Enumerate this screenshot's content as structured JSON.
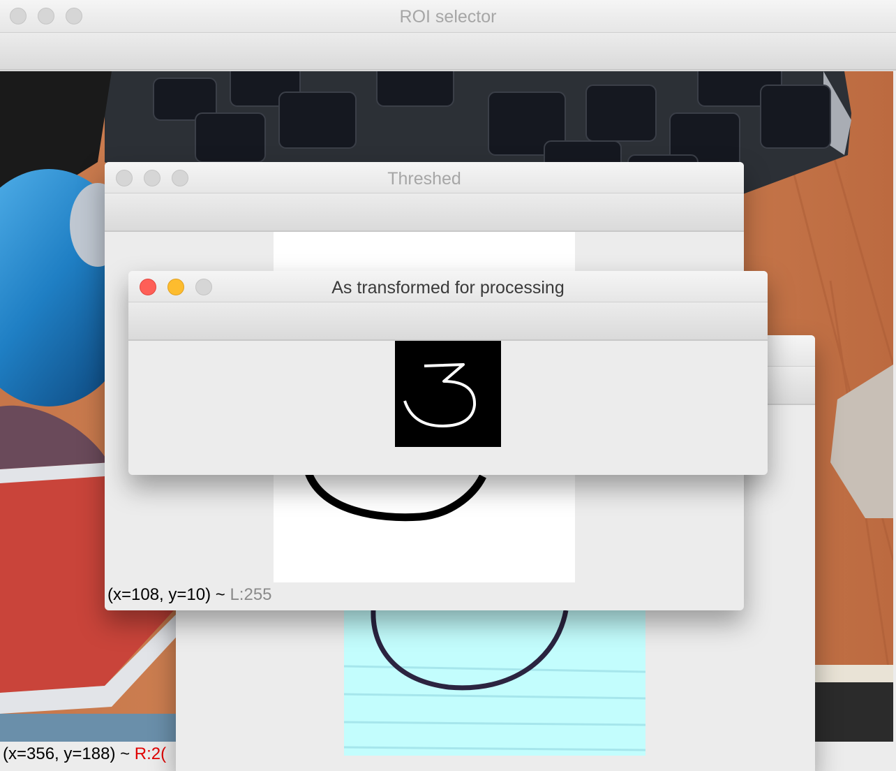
{
  "windows": {
    "roi": {
      "title": "ROI selector",
      "status_coords": "(x=356, y=188) ~ ",
      "status_value": "R:2("
    },
    "threshed": {
      "title": "Threshed",
      "status_coords": "(x=108, y=10) ~ ",
      "status_value": "L:255"
    },
    "transformed": {
      "title": "As transformed for processing",
      "digit": "3"
    }
  },
  "colors": {
    "close_red": "#fe5f57",
    "minimize_yellow": "#fdbc2e",
    "zoom_gray": "#d6d6d6",
    "sticky_note": "#c3fdfd"
  },
  "icons": [
    "window-close-icon",
    "window-minimize-icon",
    "window-zoom-icon"
  ]
}
